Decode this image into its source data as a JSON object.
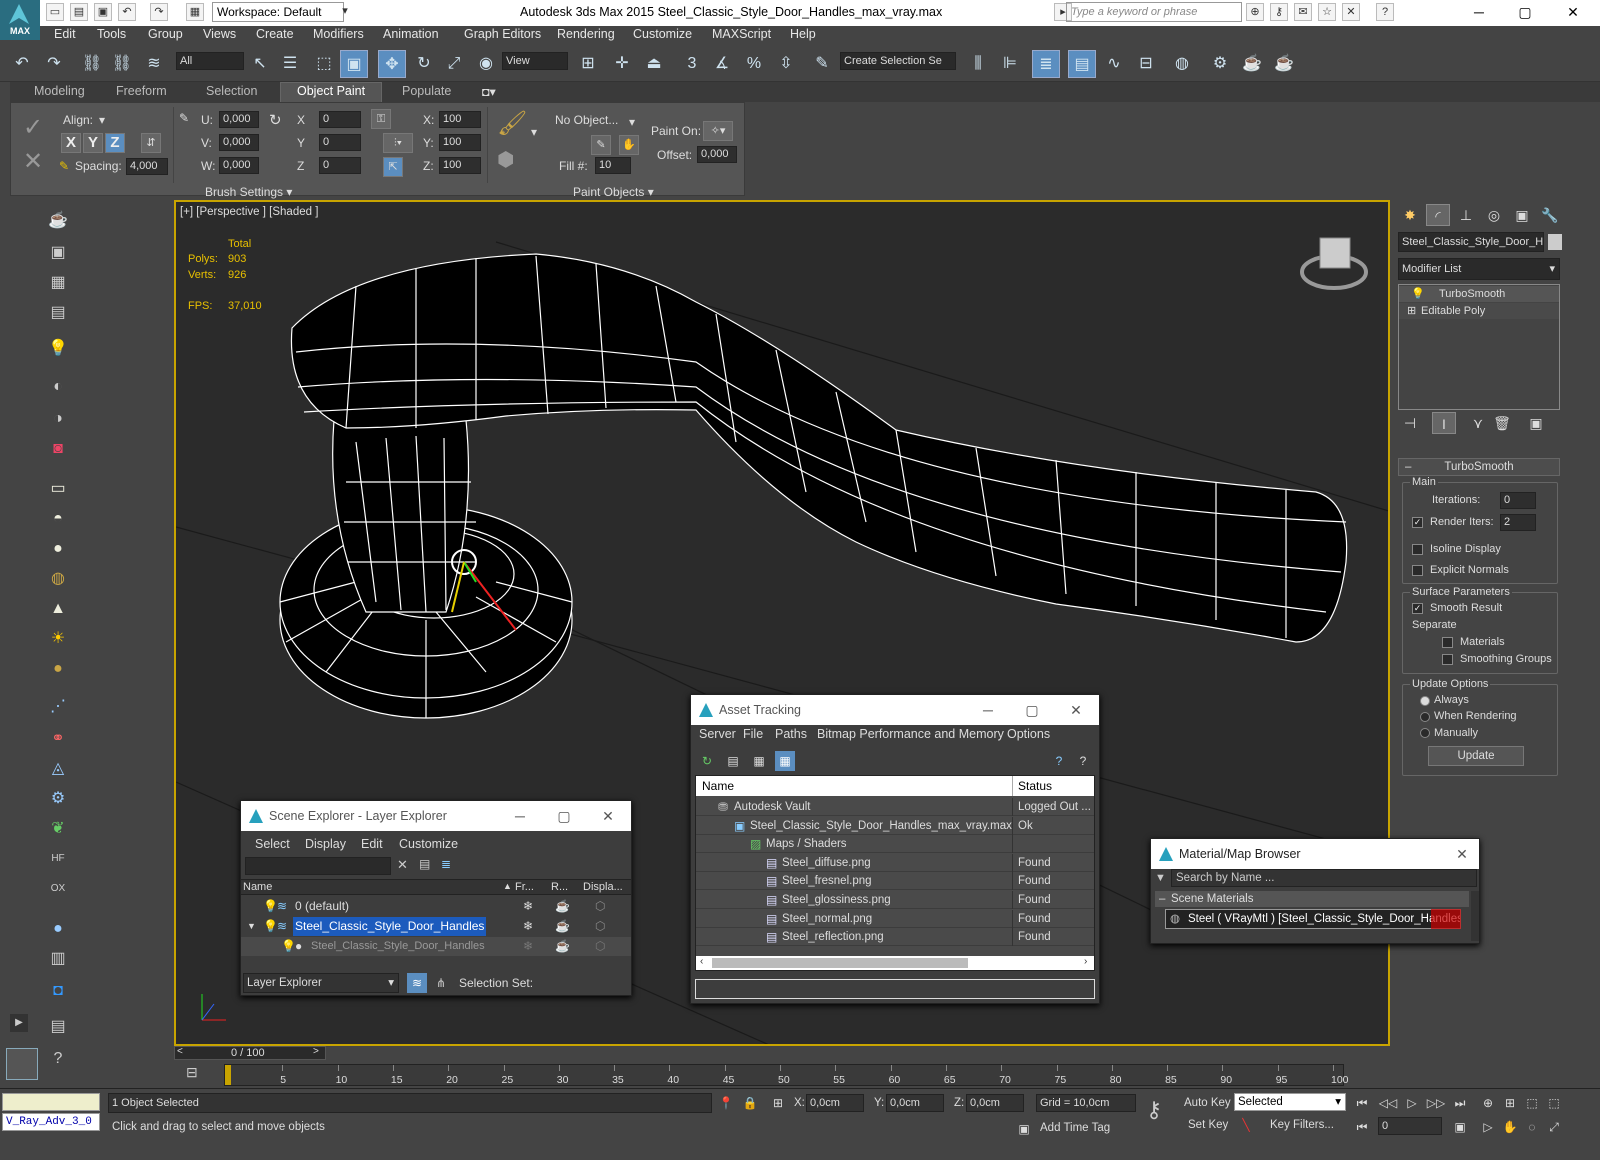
{
  "titlebar": {
    "logo_text": "MAX",
    "workspace": "Workspace: Default",
    "title": "Autodesk 3ds Max  2015    Steel_Classic_Style_Door_Handles_max_vray.max",
    "search_placeholder": "Type a keyword or phrase"
  },
  "menu": [
    "Edit",
    "Tools",
    "Group",
    "Views",
    "Create",
    "Modifiers",
    "Animation",
    "Graph Editors",
    "Rendering",
    "Customize",
    "MAXScript",
    "Help"
  ],
  "toolbar": {
    "filter": "All",
    "refcoord": "View",
    "selection_set": "Create Selection Se",
    "snap_3": "3",
    "snap_pct": "%"
  },
  "ribbon_tabs": [
    "Modeling",
    "Freeform",
    "Selection",
    "Object Paint",
    "Populate"
  ],
  "ribbon": {
    "align_label": "Align:",
    "x": "X",
    "y": "Y",
    "z": "Z",
    "spacing_label": "Spacing:",
    "spacing_value": "4,000",
    "u_label": "U:",
    "u_value": "0,000",
    "v_label": "V:",
    "v_value": "0,000",
    "w_label": "W:",
    "w_value": "0,000",
    "rx_label": "X",
    "rx_value": "0",
    "ry_label": "Y",
    "ry_value": "0",
    "rz_label": "Z",
    "rz_value": "0",
    "sx_label": "X:",
    "sx_value": "100",
    "sy_label": "Y:",
    "sy_value": "100",
    "sz_label": "Z:",
    "sz_value": "100",
    "no_object": "No Object...",
    "fill_label": "Fill #:",
    "fill_value": "10",
    "paint_on_label": "Paint On:",
    "offset_label": "Offset:",
    "offset_value": "0,000",
    "brush_settings": "Brush Settings",
    "paint_objects": "Paint Objects"
  },
  "viewport": {
    "label": "[+] [Perspective ] [Shaded ]",
    "total_label": "Total",
    "polys_label": "Polys:",
    "polys_value": "903",
    "verts_label": "Verts:",
    "verts_value": "926",
    "fps_label": "FPS:",
    "fps_value": "37,010"
  },
  "command_panel": {
    "object_name": "Steel_Classic_Style_Door_Ha",
    "modifier_list": "Modifier List",
    "stack": [
      "TurboSmooth",
      "Editable Poly"
    ],
    "rollout_title": "TurboSmooth",
    "main_label": "Main",
    "iterations_label": "Iterations:",
    "iterations_value": "0",
    "render_iters_label": "Render Iters:",
    "render_iters_value": "2",
    "isoline": "Isoline Display",
    "explicit_normals": "Explicit Normals",
    "surface_params": "Surface Parameters",
    "smooth_result": "Smooth Result",
    "separate": "Separate",
    "materials": "Materials",
    "smoothing_groups": "Smoothing Groups",
    "update_options": "Update Options",
    "always": "Always",
    "when_rendering": "When Rendering",
    "manually": "Manually",
    "update_button": "Update"
  },
  "scene_explorer": {
    "title": "Scene Explorer - Layer Explorer",
    "menu": [
      "Select",
      "Display",
      "Edit",
      "Customize"
    ],
    "columns": [
      "Name",
      "Fr...",
      "R...",
      "Displa..."
    ],
    "rows": [
      "0 (default)",
      "Steel_Classic_Style_Door_Handles",
      "Steel_Classic_Style_Door_Handles"
    ],
    "footer_dropdown": "Layer Explorer",
    "selection_set": "Selection Set:"
  },
  "asset_tracking": {
    "title": "Asset Tracking",
    "menu": [
      "Server",
      "File",
      "Paths",
      "Bitmap Performance and Memory",
      "Options"
    ],
    "columns": [
      "Name",
      "Status"
    ],
    "rows": [
      {
        "name": "Autodesk Vault",
        "status": "Logged Out ..."
      },
      {
        "name": "Steel_Classic_Style_Door_Handles_max_vray.max",
        "status": "Ok"
      },
      {
        "name": "Maps / Shaders",
        "status": ""
      },
      {
        "name": "Steel_diffuse.png",
        "status": "Found"
      },
      {
        "name": "Steel_fresnel.png",
        "status": "Found"
      },
      {
        "name": "Steel_glossiness.png",
        "status": "Found"
      },
      {
        "name": "Steel_normal.png",
        "status": "Found"
      },
      {
        "name": "Steel_reflection.png",
        "status": "Found"
      }
    ]
  },
  "material_browser": {
    "title": "Material/Map Browser",
    "search_placeholder": "Search by Name ...",
    "section": "Scene Materials",
    "item": "Steel  ( VRayMtl ) [Steel_Classic_Style_Door_Handles]"
  },
  "timeline": {
    "frame": "0 / 100",
    "ticks": [
      "0",
      "5",
      "10",
      "15",
      "20",
      "25",
      "30",
      "35",
      "40",
      "45",
      "50",
      "55",
      "60",
      "65",
      "70",
      "75",
      "80",
      "85",
      "90",
      "95",
      "100"
    ]
  },
  "status": {
    "script_listener": "V_Ray_Adv_3_0",
    "selected": "1 Object Selected",
    "prompt": "Click and drag to select and move objects",
    "x_label": "X:",
    "x_value": "0,0cm",
    "y_label": "Y:",
    "y_value": "0,0cm",
    "z_label": "Z:",
    "z_value": "0,0cm",
    "grid": "Grid = 10,0cm",
    "add_time_tag": "Add Time Tag",
    "auto_key": "Auto Key",
    "set_key": "Set Key",
    "selected_dropdown": "Selected",
    "key_filters": "Key Filters...",
    "frame_value": "0"
  },
  "colors": {
    "viewport_border": "#c8a400",
    "selection_blue": "#1c5bbd",
    "stat_yellow": "#e8c000"
  }
}
